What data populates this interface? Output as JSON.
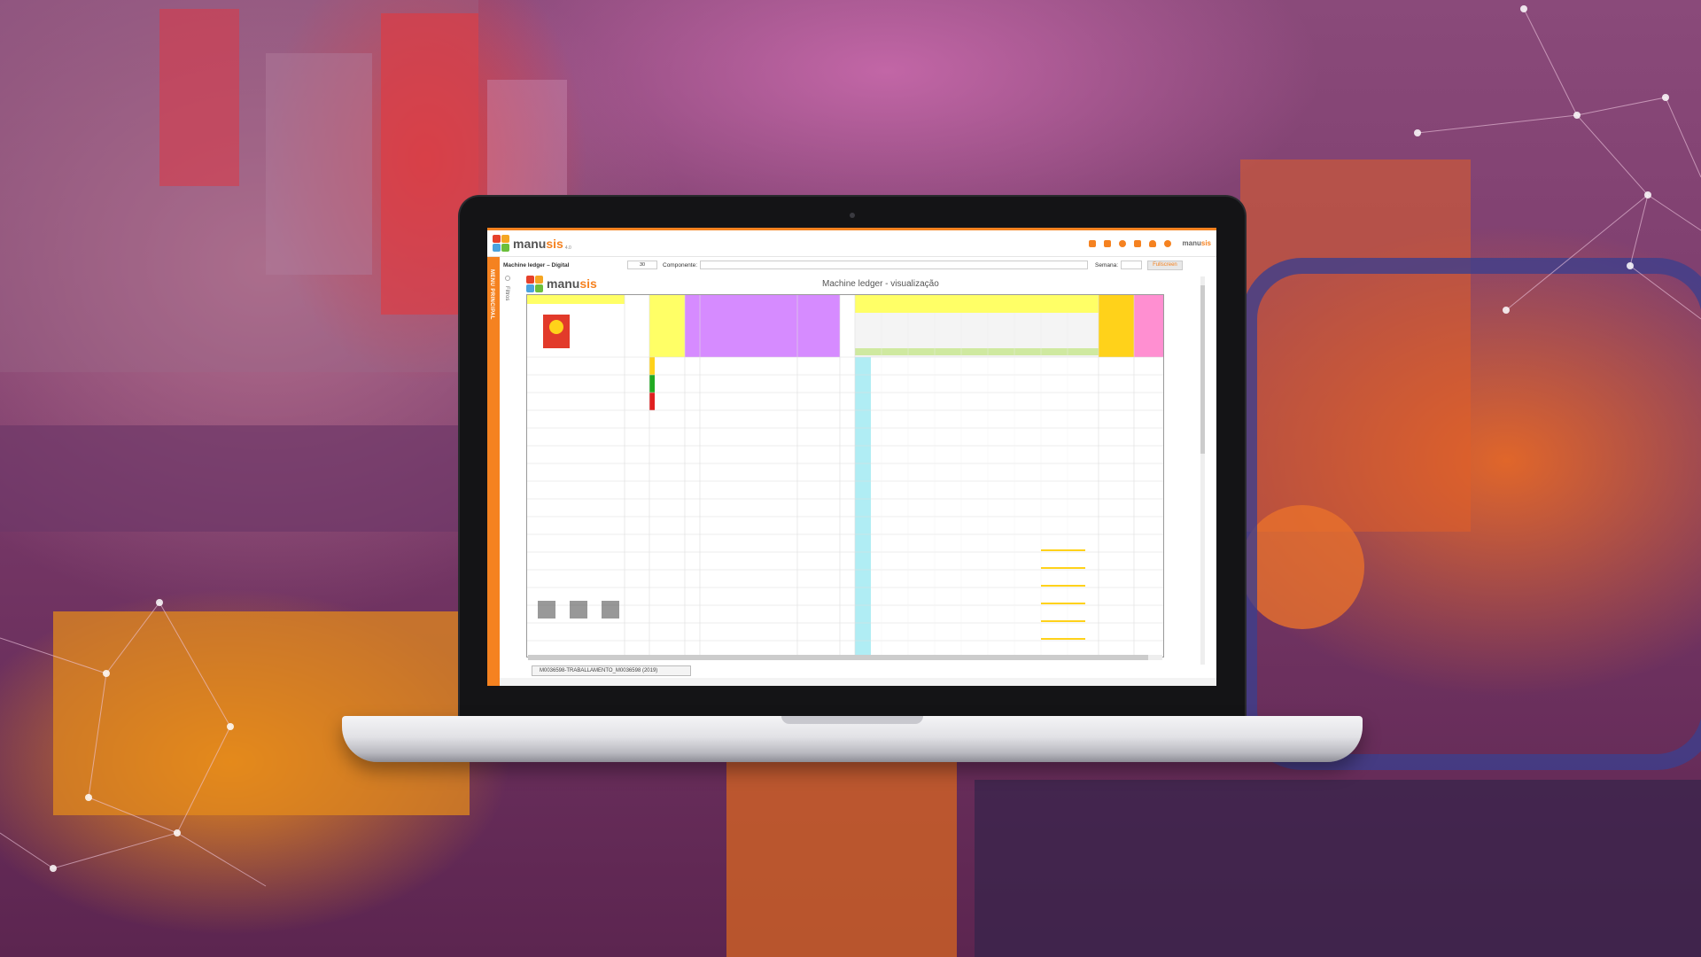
{
  "app": {
    "logo_text_a": "manu",
    "logo_text_b": "sis",
    "logo_version": "4.0",
    "brand_small_a": "manu",
    "brand_small_b": "sis",
    "sidebar_label": "MENU PRINCIPAL",
    "filters_label": "Filtros"
  },
  "toolbar": {
    "title": "Machine ledger – Digital",
    "page_size": "30",
    "component_label": "Componente:",
    "week_label": "Semana:",
    "fullscreen_button": "Fullscreen"
  },
  "document": {
    "title": "Machine ledger - visualização",
    "tab_label": "M0036598-TRABALLAMENTO_M0036598 (2019)"
  },
  "header_icons": [
    "flag-icon",
    "book-icon",
    "refresh-icon",
    "mail-icon",
    "user-icon",
    "info-icon"
  ],
  "colors": {
    "accent": "#f58220",
    "yellow": "#ffff66",
    "violet": "#d68bff",
    "cyan": "#8fe6f0",
    "pink": "#ff8fd1",
    "red": "#e02020",
    "green": "#22aa22"
  }
}
